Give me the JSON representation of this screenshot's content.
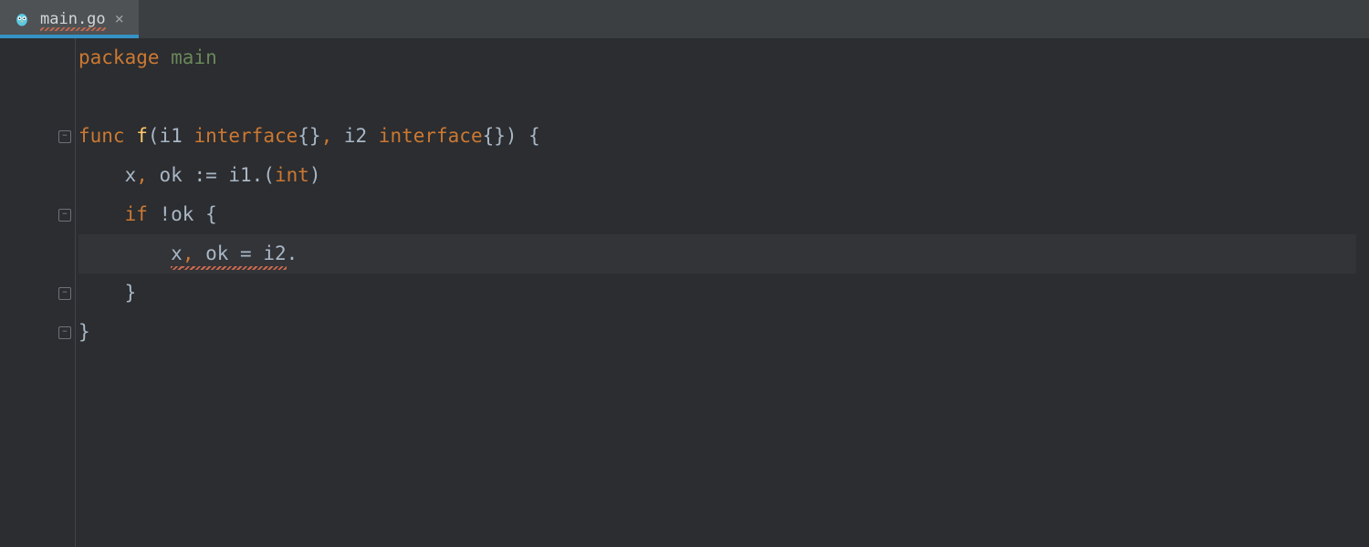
{
  "tab": {
    "filename": "main.go",
    "icon": "go-gopher-icon",
    "has_error": true,
    "active": true
  },
  "colors": {
    "bg": "#2b2d30",
    "tabbar": "#3c3f41",
    "tab_active": "#4e5254",
    "accent": "#3592c4",
    "keyword": "#cc7832",
    "string": "#6a8759",
    "func_name": "#ffc66d",
    "text": "#a9b7c6",
    "current_line": "#323438",
    "error": "#cf6a4c"
  },
  "fold_markers": [
    {
      "line_index": 2,
      "kind": "open"
    },
    {
      "line_index": 4,
      "kind": "open"
    },
    {
      "line_index": 6,
      "kind": "close"
    },
    {
      "line_index": 7,
      "kind": "close"
    }
  ],
  "current_line_index": 5,
  "code": {
    "lines": [
      {
        "seg": [
          {
            "t": "package ",
            "c": "kw"
          },
          {
            "t": "main",
            "c": "pkgname"
          }
        ]
      },
      {
        "seg": [
          {
            "t": "",
            "c": "ident"
          }
        ]
      },
      {
        "seg": [
          {
            "t": "func ",
            "c": "kw"
          },
          {
            "t": "f",
            "c": "fn"
          },
          {
            "t": "(",
            "c": "paren"
          },
          {
            "t": "i1 ",
            "c": "ident"
          },
          {
            "t": "interface",
            "c": "type"
          },
          {
            "t": "{}",
            "c": "brace"
          },
          {
            "t": ", ",
            "c": "comma"
          },
          {
            "t": "i2 ",
            "c": "ident"
          },
          {
            "t": "interface",
            "c": "type"
          },
          {
            "t": "{}",
            "c": "brace"
          },
          {
            "t": ") {",
            "c": "paren"
          }
        ]
      },
      {
        "seg": [
          {
            "t": "    x",
            "c": "ident"
          },
          {
            "t": ", ",
            "c": "comma"
          },
          {
            "t": "ok := i1.(",
            "c": "ident"
          },
          {
            "t": "int",
            "c": "type"
          },
          {
            "t": ")",
            "c": "paren"
          }
        ]
      },
      {
        "seg": [
          {
            "t": "    ",
            "c": "ident"
          },
          {
            "t": "if ",
            "c": "kw"
          },
          {
            "t": "!ok {",
            "c": "ident"
          }
        ]
      },
      {
        "seg": [
          {
            "t": "        ",
            "c": "ident"
          },
          {
            "t": "x",
            "c": "ident",
            "err": true
          },
          {
            "t": ",",
            "c": "comma",
            "err": true
          },
          {
            "t": " ok = i2",
            "c": "ident",
            "err": true
          },
          {
            "t": ".",
            "c": "dot"
          }
        ]
      },
      {
        "seg": [
          {
            "t": "    }",
            "c": "brace"
          }
        ]
      },
      {
        "seg": [
          {
            "t": "}",
            "c": "brace"
          }
        ]
      }
    ]
  }
}
